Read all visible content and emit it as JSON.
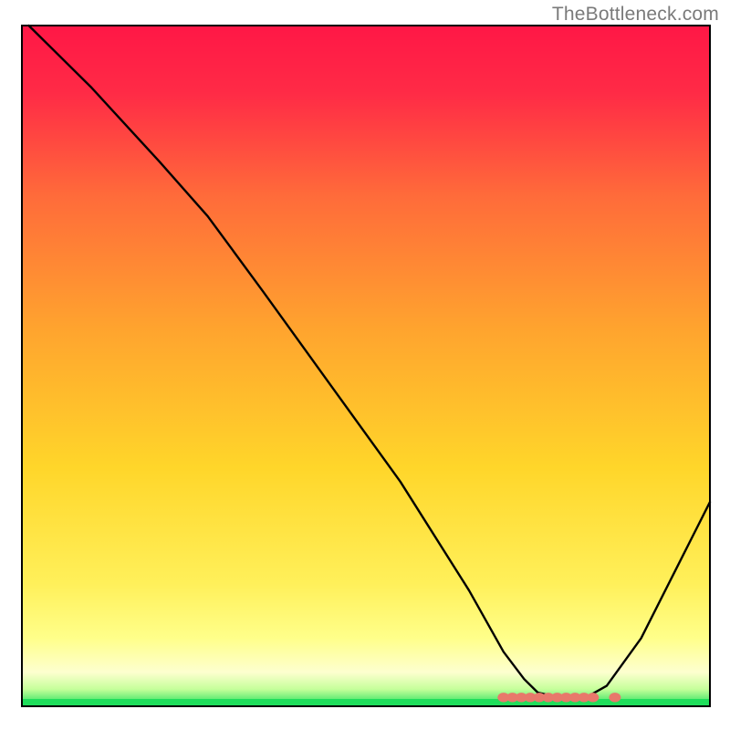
{
  "watermark": "TheBottleneck.com",
  "chart_data": {
    "type": "line",
    "title": "",
    "xlabel": "",
    "ylabel": "",
    "xlim": [
      0,
      100
    ],
    "ylim": [
      0,
      100
    ],
    "grid": false,
    "legend": false,
    "series": [
      {
        "name": "curve",
        "x": [
          1,
          10,
          20,
          27,
          35,
          45,
          55,
          65,
          70,
          73,
          75,
          78,
          82,
          85,
          90,
          95,
          100
        ],
        "y": [
          100,
          91,
          80,
          72,
          61,
          47,
          33,
          17,
          8,
          4,
          2,
          1.3,
          1.3,
          3,
          10,
          20,
          30
        ]
      }
    ],
    "annotations": [
      {
        "type": "dots",
        "x_range": [
          70,
          84
        ],
        "y": 1.3,
        "color": "#e8786b"
      }
    ],
    "colors": {
      "gradient_top": "#ff1746",
      "gradient_mid": "#ffd62a",
      "gradient_yellow": "#ffff80",
      "gradient_green": "#1fde5b",
      "curve": "#000000",
      "axes": "#000000",
      "dots": "#e8786b"
    }
  }
}
